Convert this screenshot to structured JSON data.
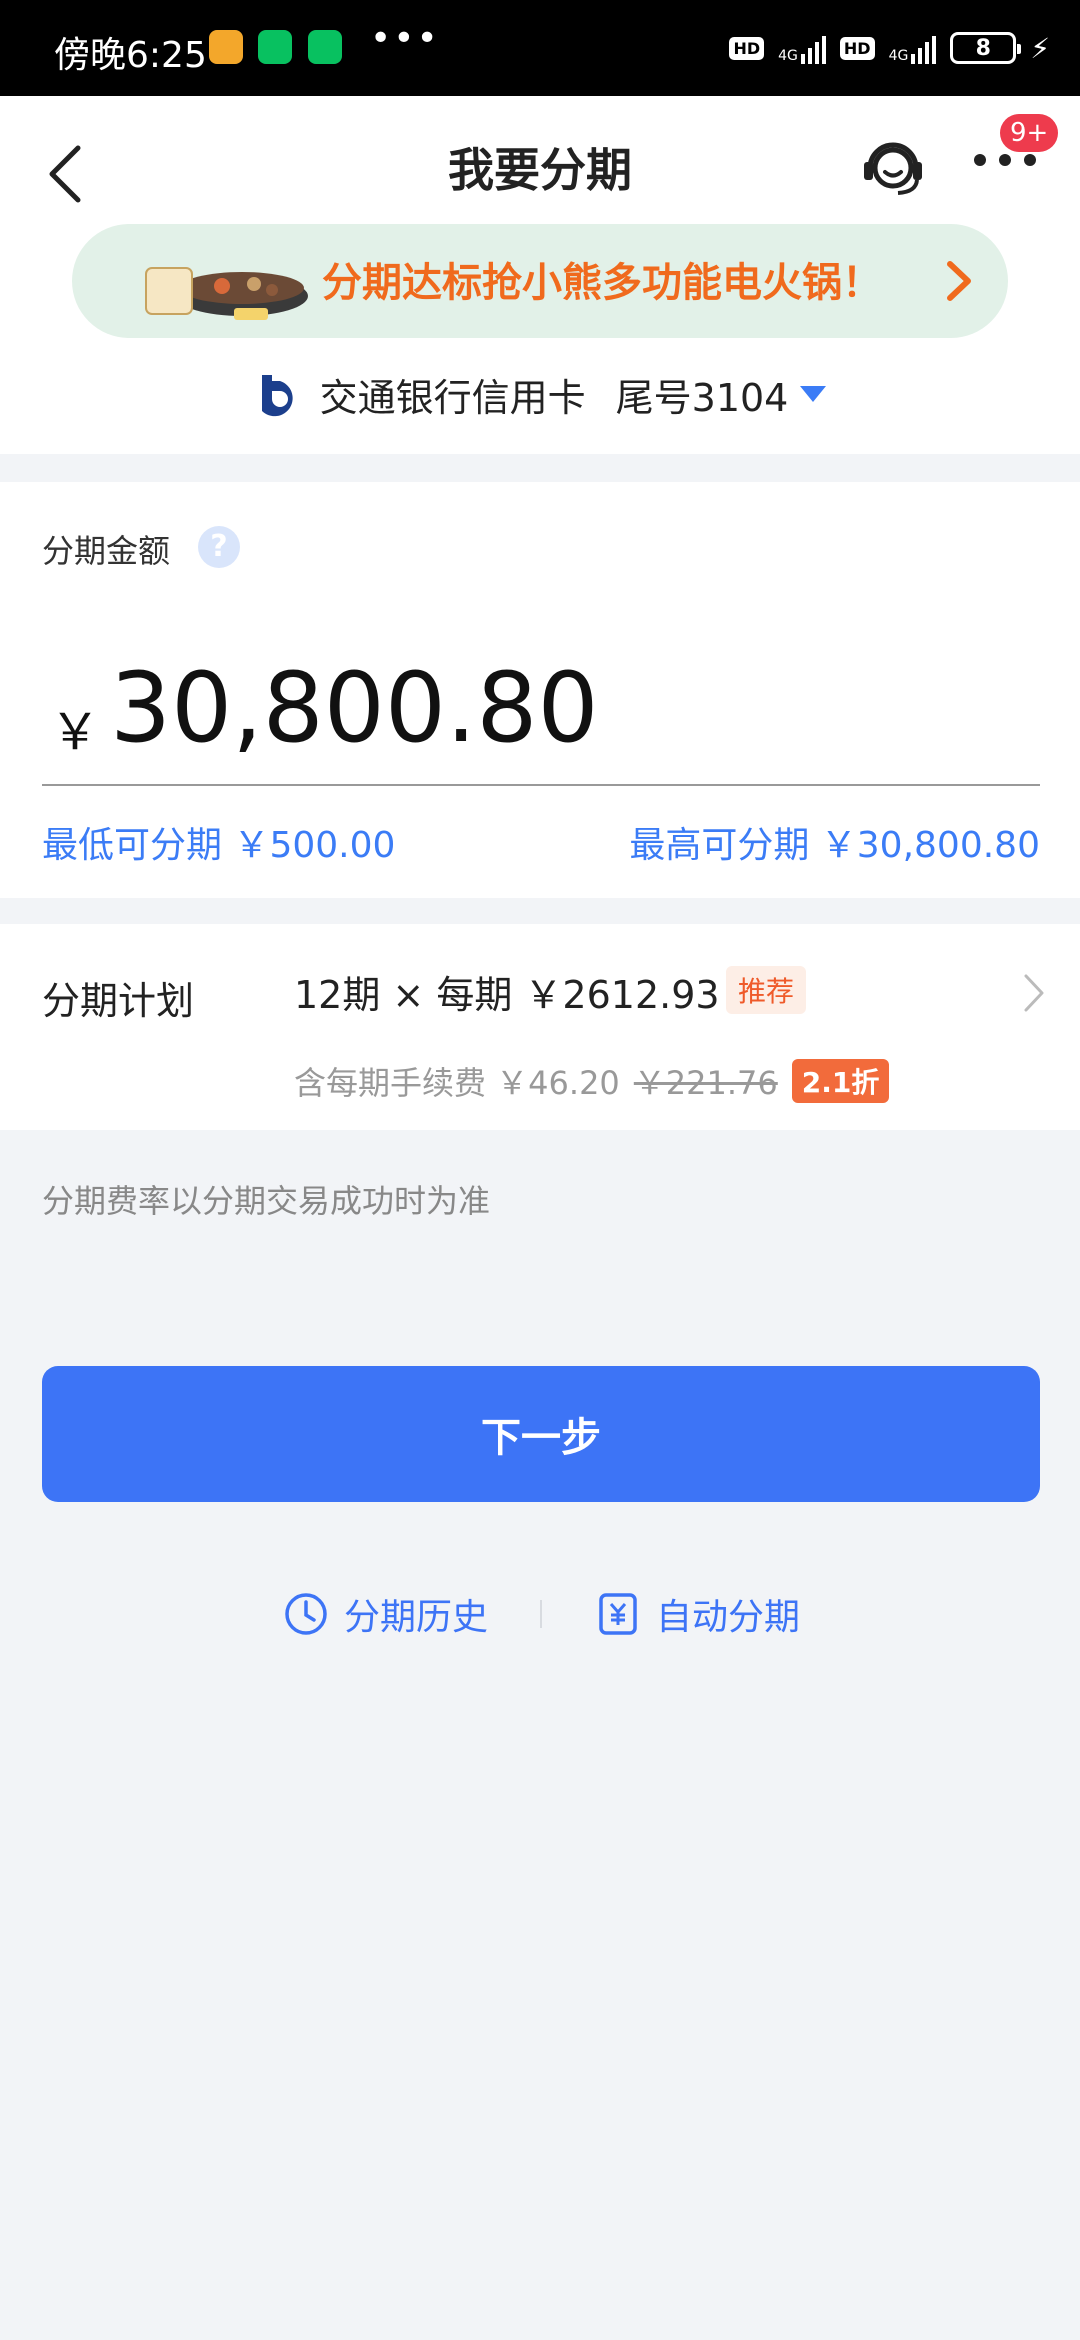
{
  "status_bar": {
    "time": "傍晚6:25",
    "dots": "•••",
    "hd1": "HD",
    "hd2": "HD",
    "net1": "4G",
    "net2": "4G",
    "battery": "8"
  },
  "header": {
    "title": "我要分期",
    "badge": "9+"
  },
  "promo": {
    "text": "分期达标抢小熊多功能电火锅！"
  },
  "card": {
    "bank": "交通银行信用卡",
    "tail": "尾号3104"
  },
  "amount": {
    "label": "分期金额",
    "help": "?",
    "currency": "￥",
    "value": "30,800.80",
    "min": "最低可分期  ￥500.00",
    "max": "最高可分期  ￥30,800.80"
  },
  "plan": {
    "label": "分期计划",
    "main": "12期 × 每期  ￥2612.93",
    "recommend": "推荐",
    "fee_prefix": "含每期手续费 ￥46.20",
    "fee_old": "￥221.76",
    "discount": "2.1折"
  },
  "note": "分期费率以分期交易成功时为准",
  "next_button": "下一步",
  "links": {
    "history": "分期历史",
    "auto": "自动分期"
  },
  "colors": {
    "accent": "#3d74f6",
    "promo_text": "#f06a1d",
    "promo_bg": "#e2f1e8",
    "discount": "#f26b3b"
  }
}
